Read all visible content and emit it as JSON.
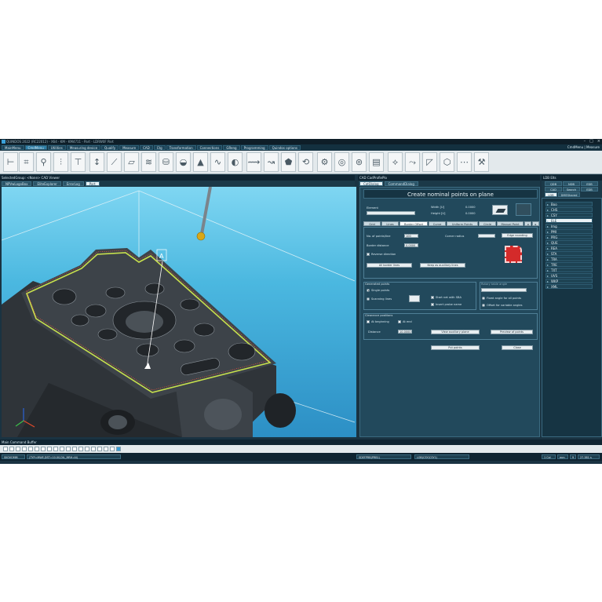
{
  "window": {
    "title": "QUINDOS 2022 (RC22012) - X64 - KM - KM4711 - Part - LDRW0F Part",
    "controls": [
      "–",
      "□",
      "×"
    ]
  },
  "menubar": {
    "items": [
      "MainMenu",
      "CmdMenu",
      "Utilities",
      "Measuring device",
      "Qualify",
      "Measure",
      "CAD",
      "Ctg",
      "Transformation",
      "Connections",
      "GReng",
      "Programming",
      "Quindos options"
    ],
    "right_label": "CmdMenu | Measure"
  },
  "left_panel": {
    "header": "SelectedGroup: <None>   CAD Viewer",
    "tabs": [
      "NPVwLogoBox",
      "EliteExplorer",
      "ErrorLog",
      "Part"
    ]
  },
  "cad_panel": {
    "header": "CAD   CadProfiePlo",
    "tabs": [
      "CatDialog",
      "CommandDialog"
    ]
  },
  "dialog": {
    "title": "Create nominal points on plane",
    "element_label": "Element",
    "width_label": "Width [U]",
    "width_value": "0.0000",
    "height_label": "Height [U]",
    "height_value": "0.0000",
    "subtabs": [
      "Grid",
      "Lines",
      "Border Offset",
      "Curve",
      "Uniform Points",
      "Circle",
      "Manual Point"
    ],
    "points_per_line_label": "No. of points/line",
    "points_per_line_value": "100",
    "border_distance_label": "Border distance",
    "border_distance_value": "0.0000",
    "corner_radius_label": "Corner radius",
    "edge_rounding_button": "Edge rounding",
    "reverse_direction_label": "Reverse direction",
    "all_border_lines_button": "All border lines",
    "keep_aux_lines_button": "Keep as auxiliary lines",
    "generated_points_label": "Generated points",
    "single_points_label": "Single points",
    "scanning_lines_label": "Scanning lines",
    "start_net_label": "Start net with SBA",
    "insert_probe_label": "Insert probe name",
    "rotary_table_label": "Rotary table angle",
    "fixed_angle_label": "Fixed angle for all points",
    "offset_angles_label": "Offset for variable angles",
    "clearance_label": "Clearance positions",
    "at_beginning_label": "At beginning",
    "at_end_label": "At end",
    "distance_label": "Distance",
    "distance_value": "10.0000",
    "view_aux_plane_button": "View auxiliary plane",
    "preview_button": "Preview of points",
    "put_points_button": "Put points",
    "close_button": "Close"
  },
  "right_panel": {
    "header": "LDB   Elts",
    "tabs_row1": [
      "QDB",
      "NDB",
      "EDB"
    ],
    "tabs_row2": [
      "CAD",
      "Search",
      "EDB"
    ],
    "tabs_row3": [
      "LDB",
      "DMEShared"
    ],
    "tree_items": [
      "Boo",
      "CHS",
      "CSY",
      "ELE",
      "Img",
      "PMI",
      "PRG",
      "QUE",
      "REA",
      "STA",
      "TRA",
      "TRE",
      "TXT",
      "UVS",
      "WKP",
      "XML"
    ],
    "selected_item": "ELE"
  },
  "command": {
    "header": "Main Command Buffer"
  },
  "status": {
    "left": "SKOVOMM",
    "left_detail": "(TYP=MWE,DST=10.00,DIL_MRH=N)",
    "cell1": "SDEFPRB(PRB1)",
    "cell2": "LOB(CSY(CSY1)",
    "coord_label": "1 Col",
    "unit_label": "mm",
    "count": "9",
    "value": "27.381 s"
  },
  "colors": {
    "frame": "#1a3342",
    "accent": "#2f7fa7",
    "viewport_sky": "#4bb8e0",
    "part_body": "#3a3f44",
    "edge_highlight": "#c7e04d"
  },
  "icons": [
    "shaft-icon",
    "measure-icon",
    "probe-icon",
    "arrow-icon",
    "spring-icon",
    "cylinder-icon",
    "sphere-icon",
    "cone-icon",
    "curve-icon",
    "torus-icon",
    "edge-icon",
    "surface-icon",
    "gear-icon",
    "disc-icon",
    "circle-icon",
    "page-icon",
    "nominal-icon",
    "cube-icon",
    "tool-icon"
  ]
}
